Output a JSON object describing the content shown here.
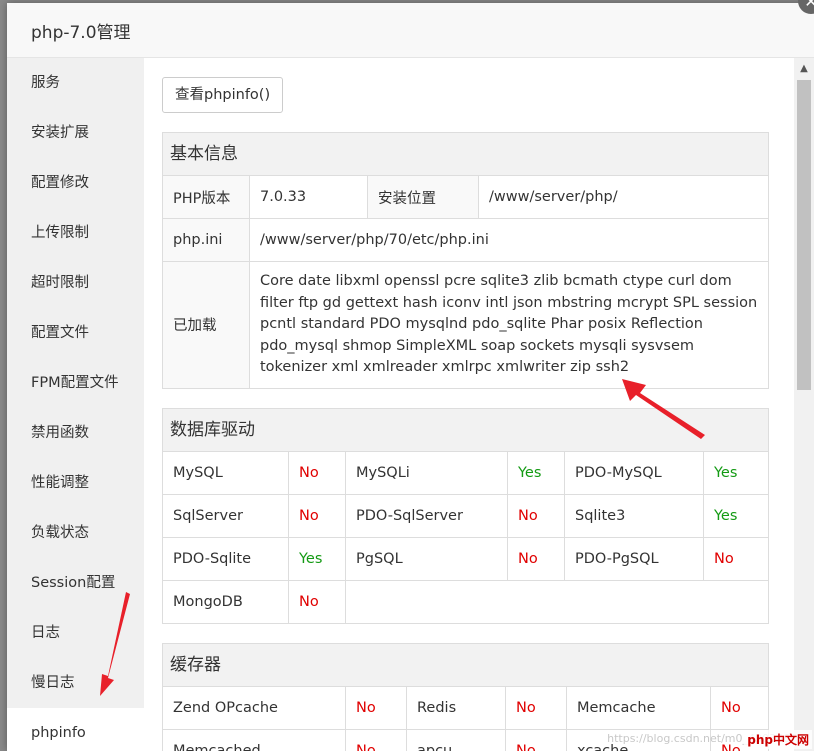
{
  "window": {
    "title": "php-7.0管理"
  },
  "sidebar": {
    "items": [
      {
        "label": "服务"
      },
      {
        "label": "安装扩展"
      },
      {
        "label": "配置修改"
      },
      {
        "label": "上传限制"
      },
      {
        "label": "超时限制"
      },
      {
        "label": "配置文件"
      },
      {
        "label": "FPM配置文件"
      },
      {
        "label": "禁用函数"
      },
      {
        "label": "性能调整"
      },
      {
        "label": "负载状态"
      },
      {
        "label": "Session配置"
      },
      {
        "label": "日志"
      },
      {
        "label": "慢日志"
      },
      {
        "label": "phpinfo"
      }
    ],
    "active_index": 13
  },
  "actions": {
    "phpinfo_button": "查看phpinfo()"
  },
  "basic_info": {
    "title": "基本信息",
    "php_version_label": "PHP版本",
    "php_version": "7.0.33",
    "install_path_label": "安装位置",
    "install_path": "/www/server/php/",
    "ini_label": "php.ini",
    "ini_path": "/www/server/php/70/etc/php.ini",
    "loaded_label": "已加载",
    "loaded_extensions": "Core date libxml openssl pcre sqlite3 zlib bcmath ctype curl dom filter ftp gd gettext hash iconv intl json mbstring mcrypt SPL session pcntl standard PDO mysqlnd pdo_sqlite Phar posix Reflection pdo_mysql shmop SimpleXML soap sockets mysqli sysvsem tokenizer xml xmlreader xmlrpc xmlwriter zip ssh2"
  },
  "db_drivers": {
    "title": "数据库驱动",
    "rows": [
      [
        {
          "name": "MySQL",
          "status": "No"
        },
        {
          "name": "MySQLi",
          "status": "Yes"
        },
        {
          "name": "PDO-MySQL",
          "status": "Yes"
        }
      ],
      [
        {
          "name": "SqlServer",
          "status": "No"
        },
        {
          "name": "PDO-SqlServer",
          "status": "No"
        },
        {
          "name": "Sqlite3",
          "status": "Yes"
        }
      ],
      [
        {
          "name": "PDO-Sqlite",
          "status": "Yes"
        },
        {
          "name": "PgSQL",
          "status": "No"
        },
        {
          "name": "PDO-PgSQL",
          "status": "No"
        }
      ],
      [
        {
          "name": "MongoDB",
          "status": "No"
        }
      ]
    ]
  },
  "cache": {
    "title": "缓存器",
    "rows": [
      [
        {
          "name": "Zend OPcache",
          "status": "No"
        },
        {
          "name": "Redis",
          "status": "No"
        },
        {
          "name": "Memcache",
          "status": "No"
        }
      ],
      [
        {
          "name": "Memcached",
          "status": "No"
        },
        {
          "name": "apcu",
          "status": "No"
        },
        {
          "name": "xcache",
          "status": "No"
        }
      ]
    ]
  },
  "colors": {
    "yes": "#139a13",
    "no": "#e00000",
    "annotation_arrow": "#e8202a"
  },
  "watermark": {
    "text": "https://blog.csdn.net/m0_43036679",
    "logo": "php中文网"
  }
}
